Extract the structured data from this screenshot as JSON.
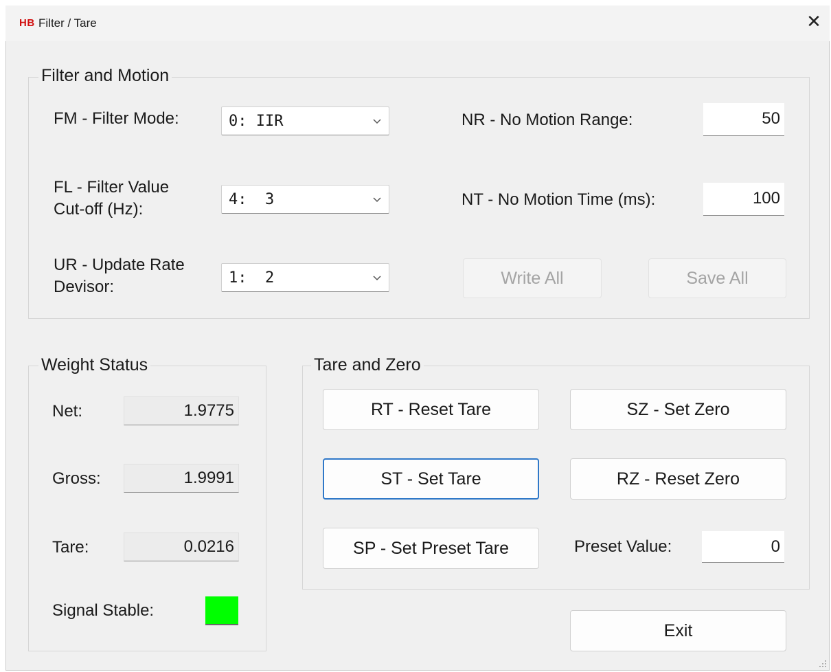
{
  "window": {
    "logo": "HB",
    "title": "Filter / Tare",
    "close_glyph": "✕"
  },
  "filter_motion": {
    "title": "Filter and Motion",
    "filter_mode": {
      "label": "FM - Filter Mode:",
      "value": "0: IIR"
    },
    "filter_value": {
      "label_line1": "FL - Filter Value",
      "label_line2": "Cut-off (Hz):",
      "value": "4:  3"
    },
    "update_rate": {
      "label_line1": "UR - Update Rate",
      "label_line2": "Devisor:",
      "value": "1:  2"
    },
    "no_motion_range": {
      "label": "NR - No Motion Range:",
      "value": "50"
    },
    "no_motion_time": {
      "label": "NT - No Motion Time (ms):",
      "value": "100"
    },
    "write_all": "Write All",
    "save_all": "Save All"
  },
  "weight_status": {
    "title": "Weight Status",
    "net": {
      "label": "Net:",
      "value": "1.9775"
    },
    "gross": {
      "label": "Gross:",
      "value": "1.9991"
    },
    "tare": {
      "label": "Tare:",
      "value": "0.0216"
    },
    "signal_stable": {
      "label": "Signal Stable:",
      "color": "#00ff00"
    }
  },
  "tare_zero": {
    "title": "Tare and Zero",
    "reset_tare": "RT - Reset Tare",
    "set_zero": "SZ - Set Zero",
    "set_tare": "ST - Set Tare",
    "reset_zero": "RZ - Reset Zero",
    "set_preset_tare": "SP - Set Preset Tare",
    "preset_label": "Preset Value:",
    "preset_value": "0"
  },
  "exit": "Exit"
}
